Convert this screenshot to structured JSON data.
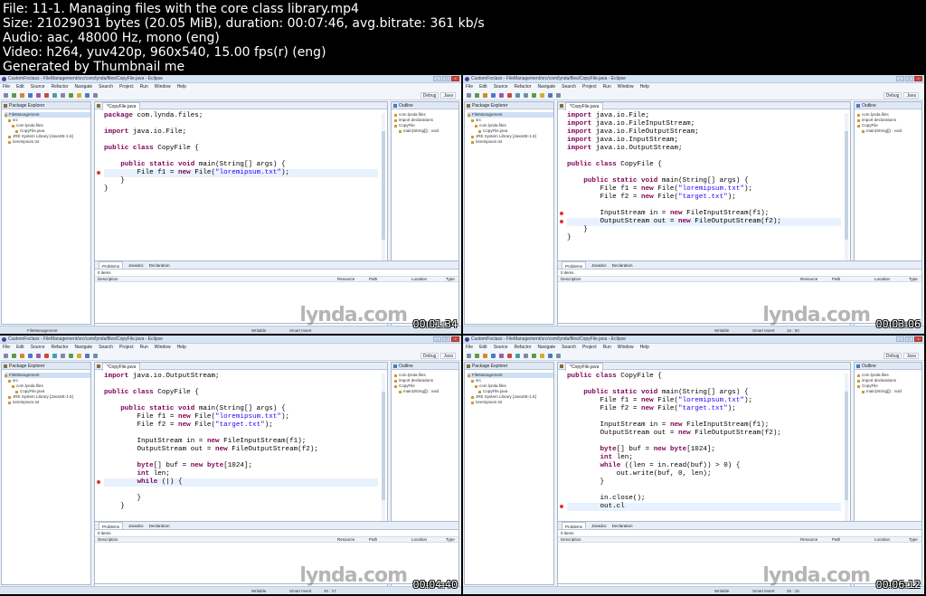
{
  "info": {
    "line1": "File: 11-1. Managing files with the core class library.mp4",
    "line2": "Size: 21029031 bytes (20.05 MiB), duration: 00:07:46, avg.bitrate: 361 kb/s",
    "line3": "Audio: aac, 48000 Hz, mono (eng)",
    "line4": "Video: h264, yuv420p, 960x540, 15.00 fps(r) (eng)",
    "line5": "Generated by Thumbnail me"
  },
  "eclipse": {
    "window_title": "CustomFoclass - FileManagement/src/com/lynda/files/CopyFile.java - Eclipse",
    "menu": [
      "File",
      "Edit",
      "Source",
      "Refactor",
      "Navigate",
      "Search",
      "Project",
      "Run",
      "Window",
      "Help"
    ],
    "perspectives": [
      "Debug",
      "Java"
    ],
    "package_explorer_title": "Package Explorer",
    "editor_tab": "*CopyFile.java",
    "outline_title": "Outline",
    "problems_tabs": [
      "Problems",
      "Javadoc",
      "Declaration"
    ],
    "problems_count": "0 items",
    "problems_columns": [
      "Description",
      "Resource",
      "Path",
      "Location",
      "Type"
    ],
    "status_writable": "Writable",
    "status_insert": "Smart Insert",
    "watermark": "lynda.com"
  },
  "frames": [
    {
      "timestamp": "00:01:34",
      "tree": [
        "FileManagement",
        "src",
        "com.lynda.files",
        "CopyFile.java",
        "JRE System Library [JavaSE-1.6]",
        "loremipsum.txt"
      ],
      "outline": [
        "com.lynda.files",
        "import declarations",
        "CopyFile",
        "main(String[]) : void"
      ],
      "status_pos": "",
      "status_left": "FileManagement",
      "code": [
        "package com.lynda.files;",
        "",
        "import java.io.File;",
        "",
        "public class CopyFile {",
        "",
        "    public static void main(String[] args) {",
        "        File f1 = new File(\"loremipsum.txt\");",
        "    }",
        "}"
      ]
    },
    {
      "timestamp": "00:03:06",
      "tree": [
        "FileManagement",
        "src",
        "com.lynda.files",
        "CopyFile.java",
        "JRE System Library [JavaSE-1.6]",
        "loremipsum.txt"
      ],
      "outline": [
        "com.lynda.files",
        "import declarations",
        "CopyFile",
        "main(String[]) : void"
      ],
      "status_pos": "16 : 50",
      "status_left": "",
      "code": [
        "import java.io.File;",
        "import java.io.FileInputStream;",
        "import java.io.FileOutputStream;",
        "import java.io.InputStream;",
        "import java.io.OutputStream;",
        "",
        "public class CopyFile {",
        "",
        "    public static void main(String[] args) {",
        "        File f1 = new File(\"loremipsum.txt\");",
        "        File f2 = new File(\"target.txt\");",
        "",
        "        InputStream in = new FileInputStream(f1);",
        "        OutputStream out = new FileOutputStream(f2);",
        "    }",
        "}"
      ]
    },
    {
      "timestamp": "00:04:40",
      "tree": [
        "FileManagement",
        "src",
        "com.lynda.files",
        "CopyFile.java",
        "JRE System Library [JavaSE-1.6]",
        "loremipsum.txt"
      ],
      "outline": [
        "com.lynda.files",
        "import declarations",
        "CopyFile",
        "main(String[]) : void"
      ],
      "status_pos": "20 : 17",
      "status_left": "",
      "code": [
        "import java.io.OutputStream;",
        "",
        "public class CopyFile {",
        "",
        "    public static void main(String[] args) {",
        "        File f1 = new File(\"loremipsum.txt\");",
        "        File f2 = new File(\"target.txt\");",
        "",
        "        InputStream in = new FileInputStream(f1);",
        "        OutputStream out = new FileOutputStream(f2);",
        "",
        "        byte[] buf = new byte[1024];",
        "        int len;",
        "        while (|) {",
        "",
        "        }",
        "    }"
      ]
    },
    {
      "timestamp": "00:06:12",
      "tree": [
        "FileManagement",
        "src",
        "com.lynda.files",
        "CopyFile.java",
        "JRE System Library [JavaSE-1.6]",
        "loremipsum.txt"
      ],
      "outline": [
        "com.lynda.files",
        "import declarations",
        "CopyFile",
        "main(String[]) : void"
      ],
      "status_pos": "25 : 15",
      "status_left": "",
      "code": [
        "public class CopyFile {",
        "",
        "    public static void main(String[] args) {",
        "        File f1 = new File(\"loremipsum.txt\");",
        "        File f2 = new File(\"target.txt\");",
        "",
        "        InputStream in = new FileInputStream(f1);",
        "        OutputStream out = new FileOutputStream(f2);",
        "",
        "        byte[] buf = new byte[1024];",
        "        int len;",
        "        while ((len = in.read(buf)) > 0) {",
        "            out.write(buf, 0, len);",
        "        }",
        "",
        "        in.close();",
        "        out.cl"
      ]
    }
  ]
}
